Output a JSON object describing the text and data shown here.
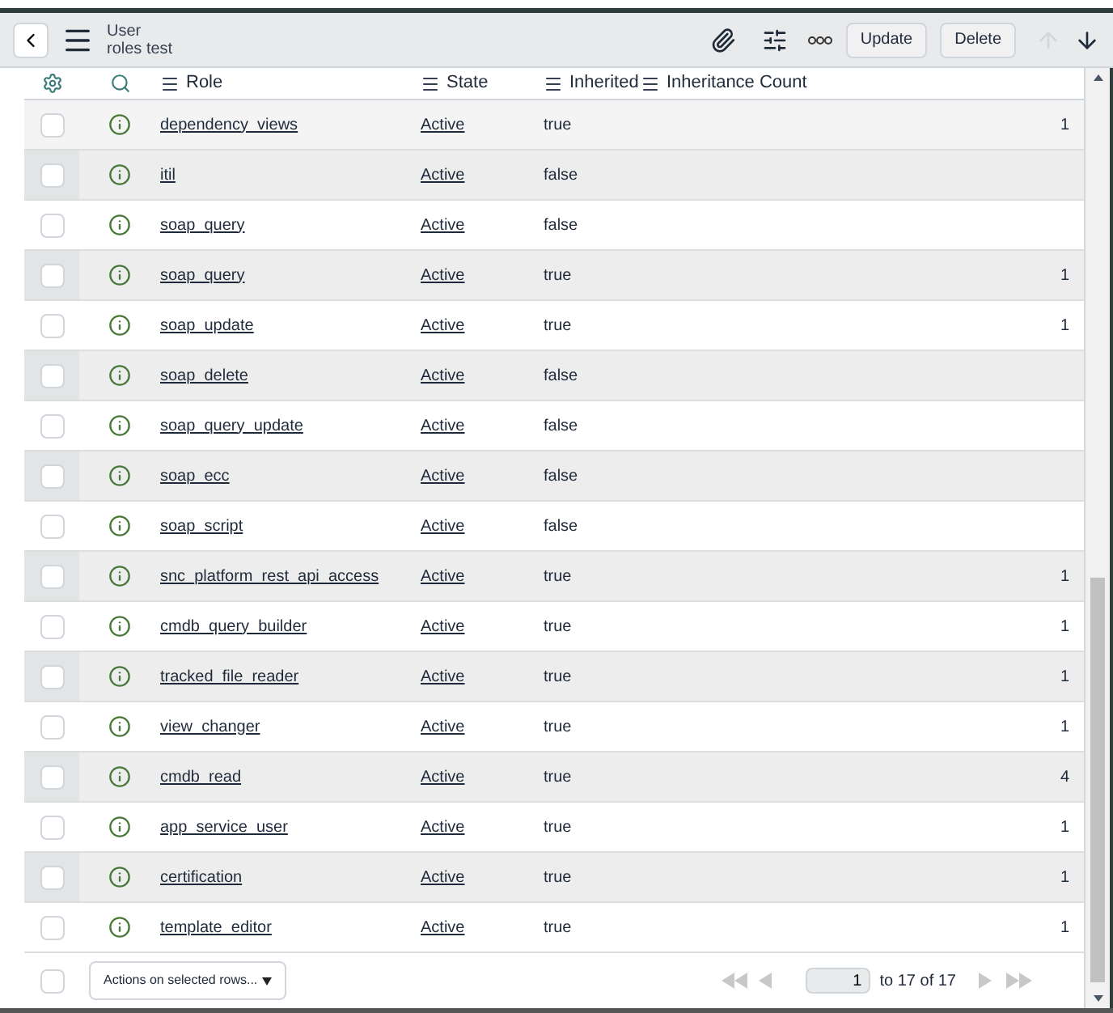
{
  "header": {
    "title": "User",
    "subtitle": "roles test",
    "buttons": [
      "Update",
      "Delete"
    ]
  },
  "columns": [
    "Role",
    "State",
    "Inherited",
    "Inheritance Count"
  ],
  "rows": [
    {
      "role": "dependency_views",
      "state": "Active",
      "inherited": "true",
      "count": "1",
      "checked": false
    },
    {
      "role": "itil",
      "state": "Active",
      "inherited": "false",
      "count": "",
      "checked": false
    },
    {
      "role": "soap_query",
      "state": "Active",
      "inherited": "false",
      "count": "",
      "checked": false
    },
    {
      "role": "soap_query",
      "state": "Active",
      "inherited": "true",
      "count": "1",
      "checked": false
    },
    {
      "role": "soap_update",
      "state": "Active",
      "inherited": "true",
      "count": "1",
      "checked": false
    },
    {
      "role": "soap_delete",
      "state": "Active",
      "inherited": "false",
      "count": "",
      "checked": false
    },
    {
      "role": "soap_query_update",
      "state": "Active",
      "inherited": "false",
      "count": "",
      "checked": false
    },
    {
      "role": "soap_ecc",
      "state": "Active",
      "inherited": "false",
      "count": "",
      "checked": false
    },
    {
      "role": "soap_script",
      "state": "Active",
      "inherited": "false",
      "count": "",
      "checked": false
    },
    {
      "role": "snc_platform_rest_api_access",
      "state": "Active",
      "inherited": "true",
      "count": "1",
      "checked": false
    },
    {
      "role": "cmdb_query_builder",
      "state": "Active",
      "inherited": "true",
      "count": "1",
      "checked": false
    },
    {
      "role": "tracked_file_reader",
      "state": "Active",
      "inherited": "true",
      "count": "1",
      "checked": false
    },
    {
      "role": "view_changer",
      "state": "Active",
      "inherited": "true",
      "count": "1",
      "checked": false
    },
    {
      "role": "cmdb_read",
      "state": "Active",
      "inherited": "true",
      "count": "4",
      "checked": false
    },
    {
      "role": "app_service_user",
      "state": "Active",
      "inherited": "true",
      "count": "1",
      "checked": false
    },
    {
      "role": "certification",
      "state": "Active",
      "inherited": "true",
      "count": "1",
      "checked": false
    },
    {
      "role": "template_editor",
      "state": "Active",
      "inherited": "true",
      "count": "1",
      "checked": false
    }
  ],
  "footer": {
    "select_all_checked": false,
    "actions": "Actions on selected rows...",
    "page": "1",
    "range": "to 17 of 17"
  }
}
